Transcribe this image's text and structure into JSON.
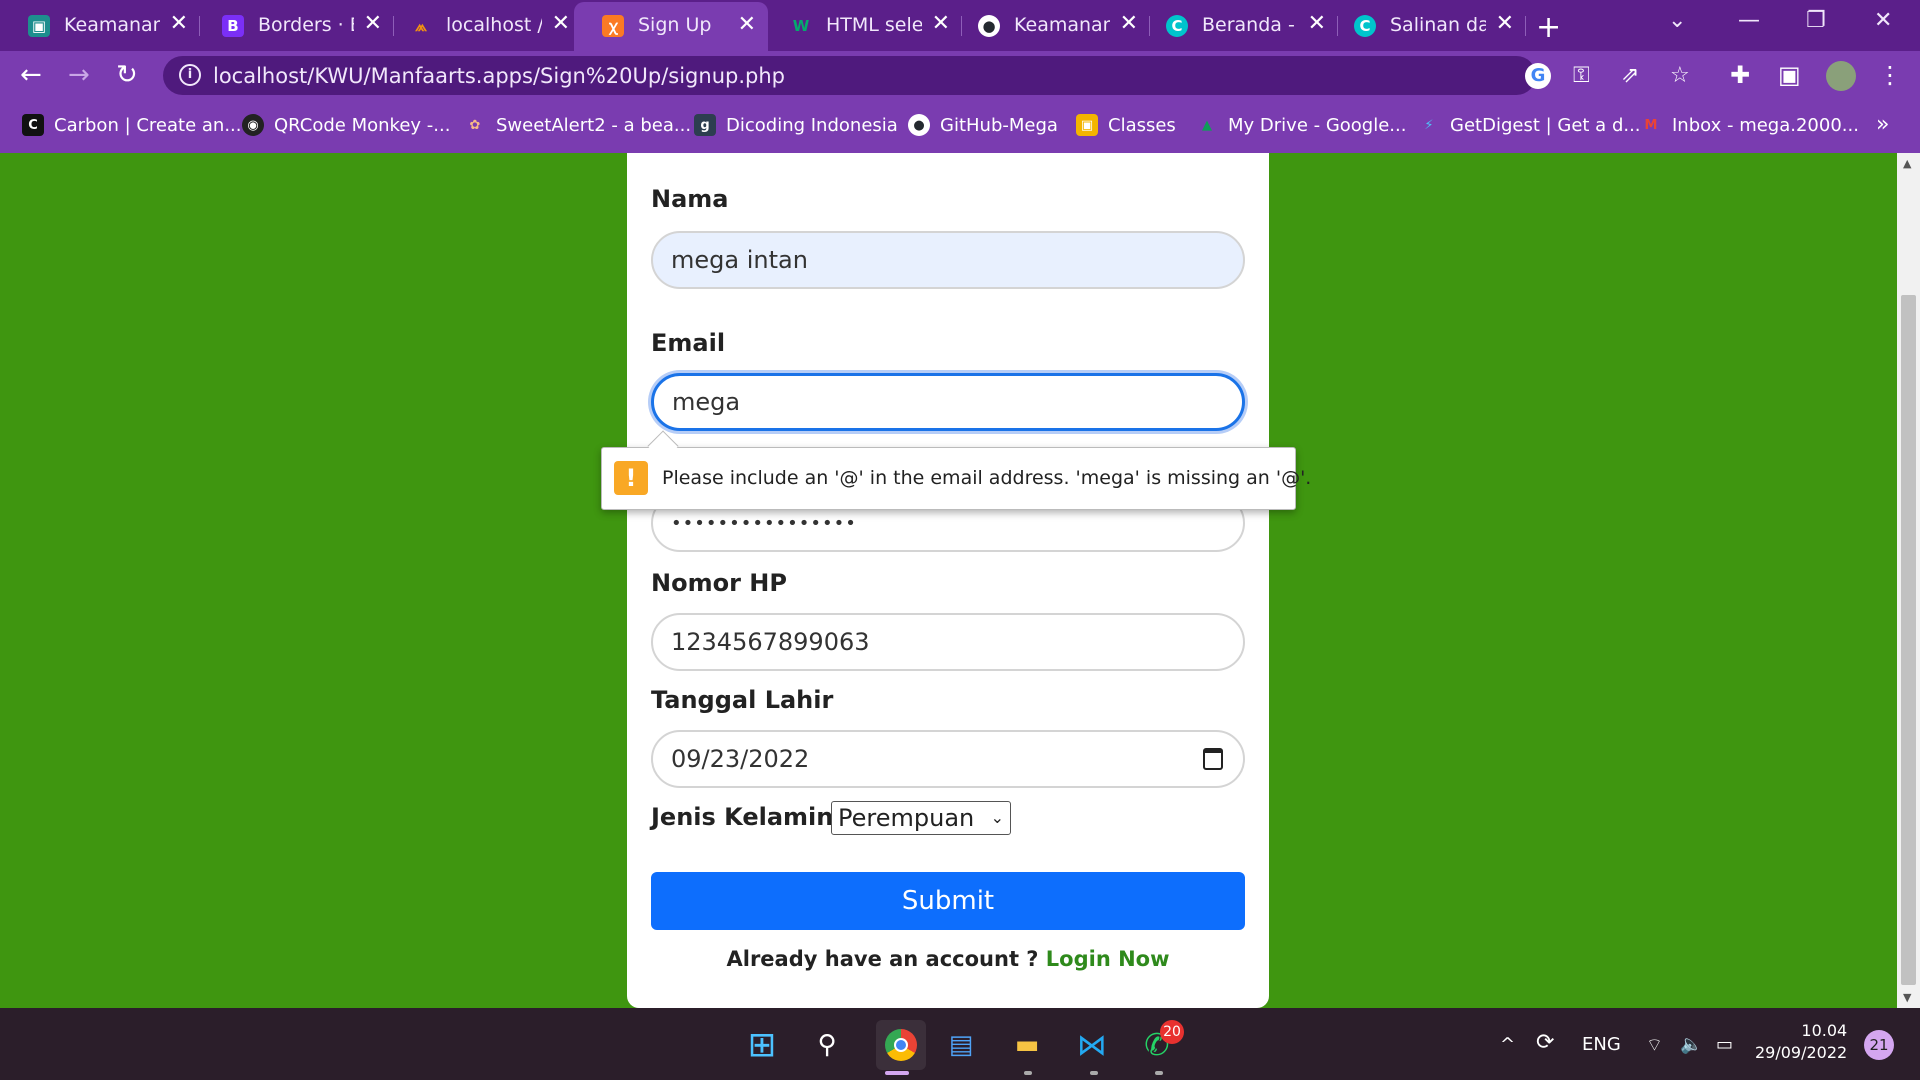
{
  "tabs": [
    {
      "title": "Keamanan I",
      "icon": "classroom-icon",
      "color": "#1e8e8e"
    },
    {
      "title": "Borders · Bo",
      "icon": "bootstrap-icon",
      "color": "#7b2ff7"
    },
    {
      "title": "localhost /",
      "icon": "phpmyadmin-icon",
      "color": "#f29111"
    },
    {
      "title": "Sign Up",
      "icon": "xampp-icon",
      "color": "#fb7a24"
    },
    {
      "title": "HTML selec",
      "icon": "w3schools-icon",
      "color": "#04aa6d"
    },
    {
      "title": "Keamanan-",
      "icon": "github-icon",
      "color": "#24292f"
    },
    {
      "title": "Beranda - C",
      "icon": "canva-icon",
      "color": "#00c4cc"
    },
    {
      "title": "Salinan dar",
      "icon": "canva-icon",
      "color": "#00c4cc"
    }
  ],
  "active_tab": "Sign Up",
  "address_bar": {
    "url": "localhost/KWU/Manfaarts.apps/Sign%20Up/signup.php"
  },
  "bookmarks": [
    {
      "label": "Carbon | Create an...",
      "icon": "carbon-icon"
    },
    {
      "label": "QRCode Monkey -...",
      "icon": "qrcode-monkey-icon"
    },
    {
      "label": "SweetAlert2 - a bea...",
      "icon": "sweetalert-icon"
    },
    {
      "label": "Dicoding Indonesia",
      "icon": "dicoding-icon"
    },
    {
      "label": "GitHub-Mega",
      "icon": "github-icon"
    },
    {
      "label": "Classes",
      "icon": "classroom-icon"
    },
    {
      "label": "My Drive - Google...",
      "icon": "google-drive-icon"
    },
    {
      "label": "GetDigest | Get a d...",
      "icon": "getdigest-icon"
    },
    {
      "label": "Inbox - mega.2000...",
      "icon": "gmail-icon"
    }
  ],
  "form": {
    "nama_label": "Nama",
    "nama_value": "mega intan",
    "email_label": "Email",
    "email_value": "mega",
    "password_value": "••••••••••••••••",
    "hp_label": "Nomor HP",
    "hp_value": "1234567899063",
    "tanggal_label": "Tanggal Lahir",
    "tanggal_value": "09/23/2022",
    "kelamin_label": "Jenis Kelamin",
    "kelamin_value": "Perempuan",
    "submit_label": "Submit",
    "footer_text": "Already have an account ?",
    "footer_link": "Login Now"
  },
  "validation": {
    "message": "Please include an '@' in the email address. 'mega' is missing an '@'.",
    "icon": "warning-icon"
  },
  "taskbar": {
    "language": "ENG",
    "time": "10.04",
    "date": "29/09/2022",
    "notification_count": "21",
    "whatsapp_badge": "20"
  },
  "colors": {
    "page_background": "#3f9610",
    "browser_theme": "#7a3cb0",
    "submit_button": "#0d6efd",
    "link": "#2f8a1c"
  }
}
